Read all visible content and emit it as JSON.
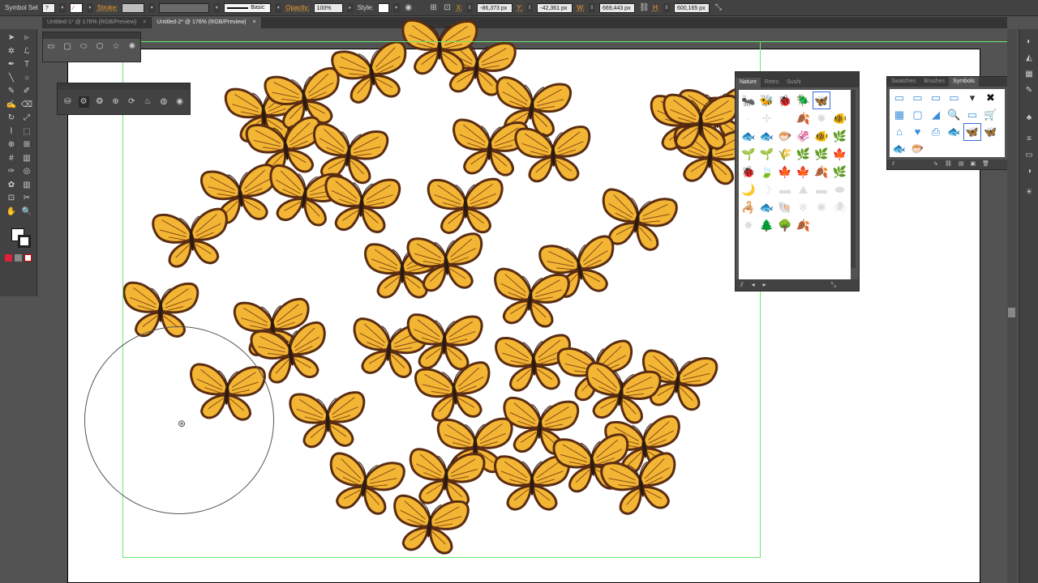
{
  "toolbar": {
    "tool_name": "Symbol Set",
    "stroke_label": "Stroke:",
    "brush_label": "Basic",
    "opacity_label": "Opacity:",
    "opacity_value": "100%",
    "style_label": "Style:",
    "x_label": "X:",
    "x_value": "-86,373 px",
    "y_label": "Y:",
    "y_value": "-42,361 px",
    "w_label": "W:",
    "w_value": "669,443 px",
    "h_label": "H:",
    "h_value": "600,165 px"
  },
  "tabs": [
    {
      "label": "Untitled-1* @ 176% (RGB/Preview)",
      "close": "×",
      "active": false
    },
    {
      "label": "Untitled-2* @ 176% (RGB/Preview)",
      "close": "×",
      "active": true
    }
  ],
  "nature_panel": {
    "tabs": [
      "Nature",
      "Retro",
      "Sushi"
    ],
    "active_tab": "Nature"
  },
  "symbols_panel": {
    "tabs": [
      "Swatches",
      "Brushes",
      "Symbols"
    ],
    "active_tab": "Symbols"
  },
  "colors": {
    "ui_dark": "#424242",
    "ui_mid": "#535353",
    "guide": "#6ee66e",
    "butterfly_fill": "#f3b634",
    "butterfly_outline": "#5a2c12",
    "toolbar_label_orange": "#f0a030"
  },
  "icons": {
    "tools": [
      "selection-icon",
      "direct-selection-icon",
      "magic-wand-icon",
      "lasso-icon",
      "pen-icon",
      "type-icon",
      "line-icon",
      "ellipse-icon",
      "brush-icon",
      "pencil-icon",
      "blob-brush-icon",
      "eraser-icon",
      "rotate-icon",
      "scale-icon",
      "warp-icon",
      "free-transform-icon",
      "shape-builder-icon",
      "perspective-icon",
      "mesh-icon",
      "gradient-icon",
      "eyedropper-icon",
      "blend-icon",
      "symbol-sprayer-icon",
      "graph-icon",
      "artboard-icon",
      "slice-icon",
      "hand-icon",
      "zoom-icon"
    ]
  }
}
